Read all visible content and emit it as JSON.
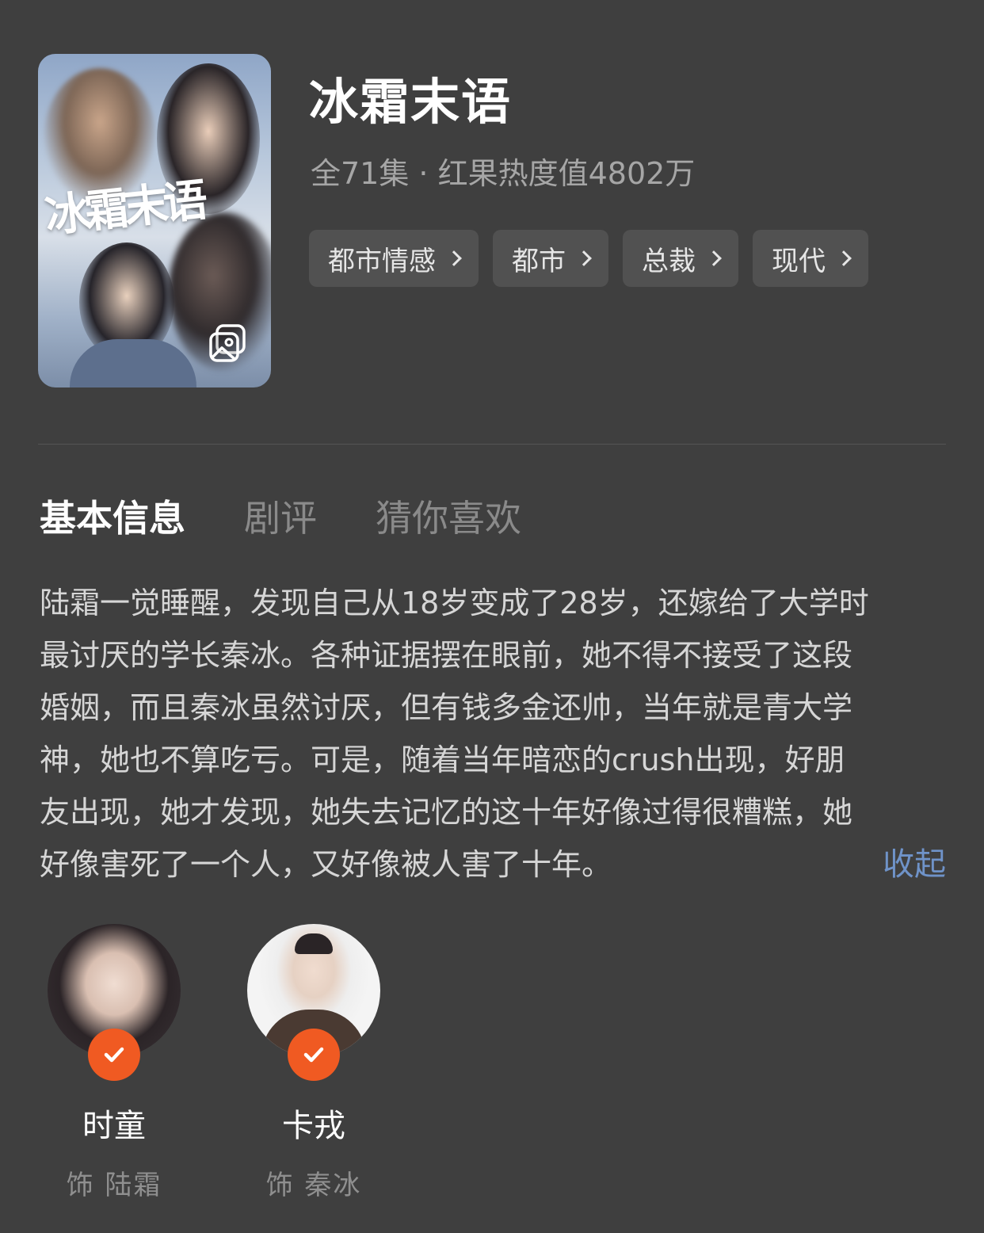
{
  "drama": {
    "title": "冰霜末语",
    "poster_text": "冰霜末语",
    "meta": "全71集 · 红果热度值4802万",
    "tags": [
      "都市情感",
      "都市",
      "总裁",
      "现代"
    ]
  },
  "tabs": [
    {
      "label": "基本信息",
      "active": true
    },
    {
      "label": "剧评",
      "active": false
    },
    {
      "label": "猜你喜欢",
      "active": false
    }
  ],
  "description": {
    "lines": [
      "陆霜一觉睡醒，发现自己从18岁变成了28岁，还嫁给了大学时",
      "最讨厌的学长秦冰。各种证据摆在眼前，她不得不接受了这段",
      "婚姻，而且秦冰虽然讨厌，但有钱多金还帅，当年就是青大学",
      "神，她也不算吃亏。可是，随着当年暗恋的crush出现，好朋",
      "友出现，她才发现，她失去记忆的这十年好像过得很糟糕，她",
      "好像害死了一个人，又好像被人害了十年。"
    ],
    "collapse_label": "收起"
  },
  "cast": [
    {
      "name": "时童",
      "role": "饰 陆霜"
    },
    {
      "name": "卡戎",
      "role": "饰 秦冰"
    }
  ],
  "colors": {
    "background": "#3f3f3f",
    "accent_badge": "#f05a22",
    "link": "#6f93c9"
  },
  "icons": {
    "gallery": "gallery-icon",
    "tag_chevron": "chevron-right-icon",
    "verified": "check-badge-icon"
  }
}
